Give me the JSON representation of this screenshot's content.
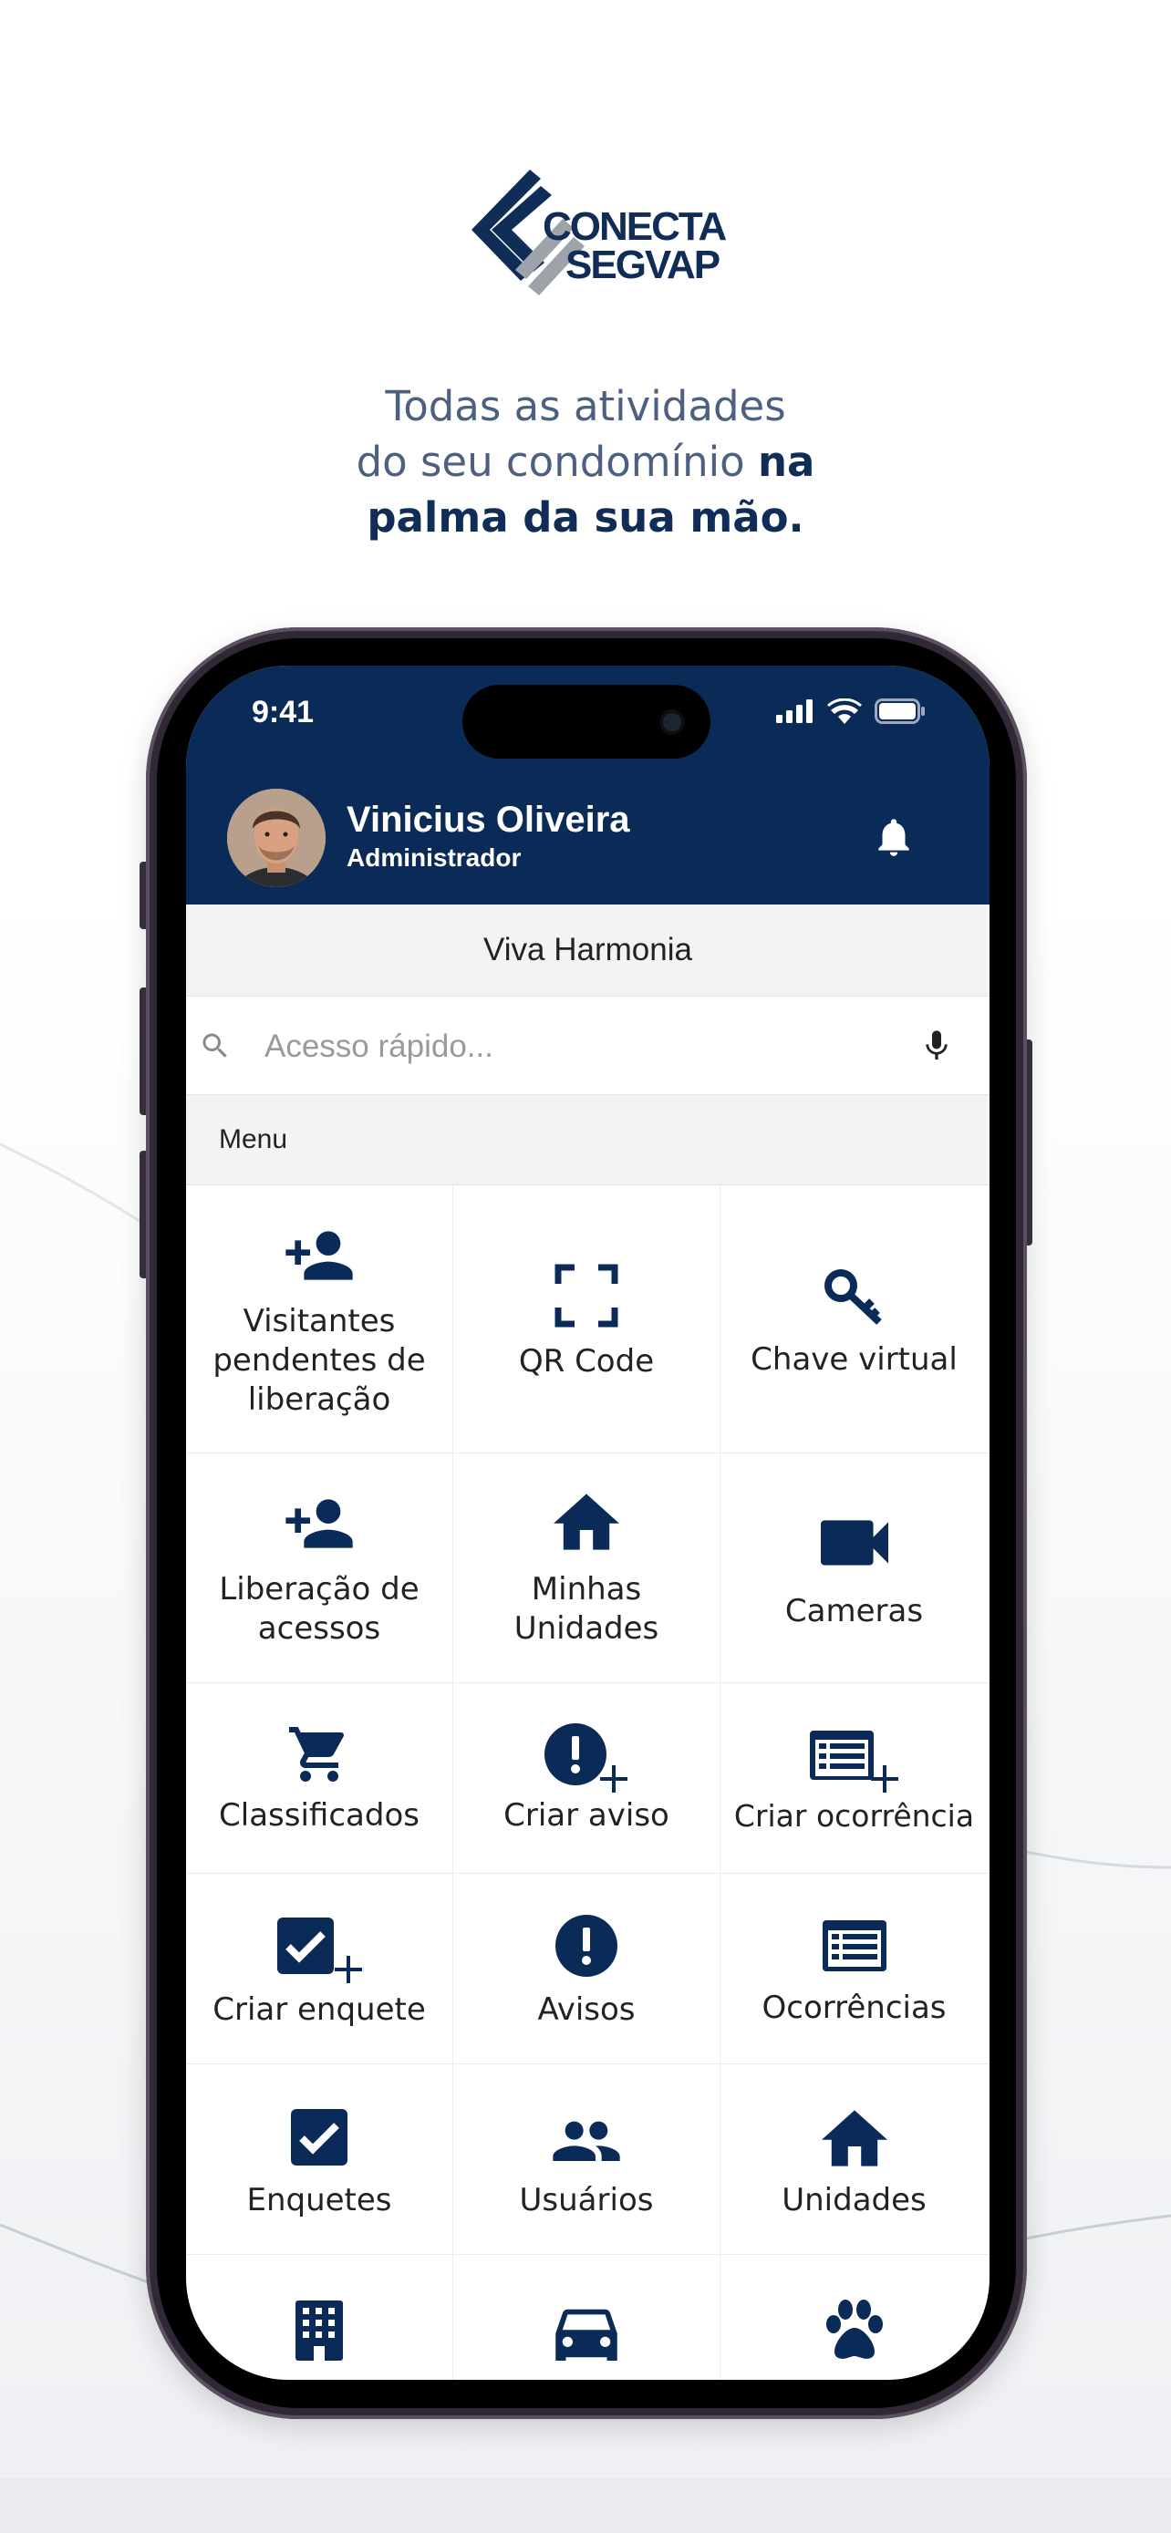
{
  "brand": {
    "line1": "CONECTA",
    "line2": "SEGVAP"
  },
  "tagline": {
    "part1": "Todas as atividades",
    "part2": "do seu condomínio",
    "bold1": "na",
    "bold2": "palma da sua mão."
  },
  "status_bar": {
    "time": "9:41"
  },
  "user": {
    "name": "Vinicius Oliveira",
    "role": "Administrador"
  },
  "condo_name": "Viva Harmonia",
  "search": {
    "placeholder": "Acesso rápido..."
  },
  "menu": {
    "title": "Menu",
    "items": [
      {
        "label": "Visitantes pendentes de liberação",
        "icon": "person-add-icon"
      },
      {
        "label": "QR Code",
        "icon": "qr-scan-icon"
      },
      {
        "label": "Chave virtual",
        "icon": "key-icon"
      },
      {
        "label": "Liberação de acessos",
        "icon": "person-add-icon"
      },
      {
        "label": "Minhas Unidades",
        "icon": "home-icon"
      },
      {
        "label": "Cameras",
        "icon": "video-camera-icon"
      },
      {
        "label": "Classificados",
        "icon": "cart-icon"
      },
      {
        "label": "Criar aviso",
        "icon": "alert-add-icon"
      },
      {
        "label": "Criar ocorrência",
        "icon": "list-add-icon"
      },
      {
        "label": "Criar enquete",
        "icon": "check-add-icon"
      },
      {
        "label": "Avisos",
        "icon": "alert-icon"
      },
      {
        "label": "Ocorrências",
        "icon": "list-icon"
      },
      {
        "label": "Enquetes",
        "icon": "checkbox-icon"
      },
      {
        "label": "Usuários",
        "icon": "people-icon"
      },
      {
        "label": "Unidades",
        "icon": "home-icon"
      },
      {
        "label": "",
        "icon": "building-icon"
      },
      {
        "label": "",
        "icon": "car-icon"
      },
      {
        "label": "",
        "icon": "paw-icon"
      }
    ]
  },
  "colors": {
    "primary": "#0a2a57",
    "accent": "#0f2d57",
    "logo_grey": "#9ea3aa"
  }
}
